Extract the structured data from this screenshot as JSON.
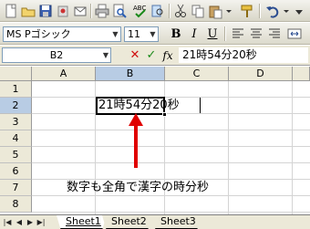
{
  "toolbar": {
    "icons": [
      "new-icon",
      "open-icon",
      "save-icon",
      "permission-icon",
      "email-icon",
      "print-icon",
      "print-preview-icon",
      "spelling-icon",
      "research-icon",
      "cut-icon",
      "copy-icon",
      "paste-icon",
      "format-painter-icon"
    ]
  },
  "format_toolbar": {
    "font_name": "MS Pゴシック",
    "font_size": "11",
    "bold": "B",
    "italic": "I",
    "underline": "U"
  },
  "formula_bar": {
    "name_box": "B2",
    "cancel": "✕",
    "enter": "✓",
    "fx": "fx",
    "content": "21時54分20秒"
  },
  "grid": {
    "columns": [
      "A",
      "B",
      "C",
      "D"
    ],
    "rows": [
      "1",
      "2",
      "3",
      "4",
      "5",
      "6",
      "7",
      "8"
    ],
    "active_column": "B",
    "active_row": "2",
    "cell_b2": "21時54分20秒"
  },
  "annotation": {
    "text": "数字も全角で漢字の時分秒",
    "arrow_color": "#e00000"
  },
  "sheets": {
    "tabs": [
      "Sheet1",
      "Sheet2",
      "Sheet3"
    ],
    "active": "Sheet1"
  }
}
